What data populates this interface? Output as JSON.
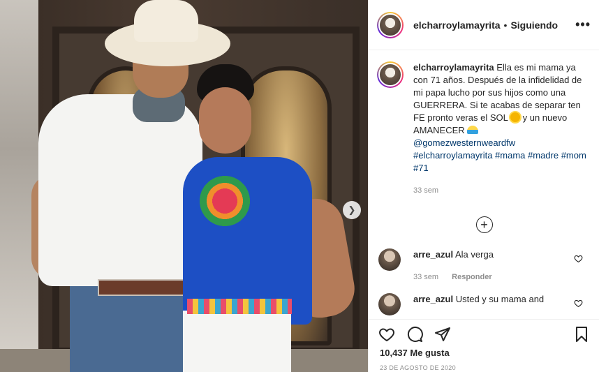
{
  "post": {
    "next_icon": "chevron-right-icon"
  },
  "header": {
    "username": "elcharroylamayrita",
    "separator": "•",
    "follow_label": "Siguiendo",
    "more_label": "•••"
  },
  "caption": {
    "username": "elcharroylamayrita",
    "text_1": "Ella es mi mama ya con 71 años. Después de la infidelidad de mi papa lucho por sus hijos como una GUERRERA. Si te acabas de separar ten FE pronto veras el SOL",
    "text_2": "y un nuevo AMANECER",
    "mention": "@gomezwesternweardfw",
    "hashtags": "#elcharroylamayrita #mama #madre #mom #71",
    "time": "33 sem"
  },
  "comments": [
    {
      "username": "arre_azul",
      "text": "Ala verga",
      "time": "33 sem",
      "reply_label": "Responder"
    },
    {
      "username": "arre_azul",
      "text": "Usted y su mama and",
      "time": "",
      "reply_label": ""
    }
  ],
  "actions": {
    "likes": "10,437 Me gusta",
    "date": "23 DE AGOSTO DE 2020"
  },
  "colors": {
    "link": "#00376b",
    "muted": "#8e8e8e",
    "text": "#262626"
  }
}
